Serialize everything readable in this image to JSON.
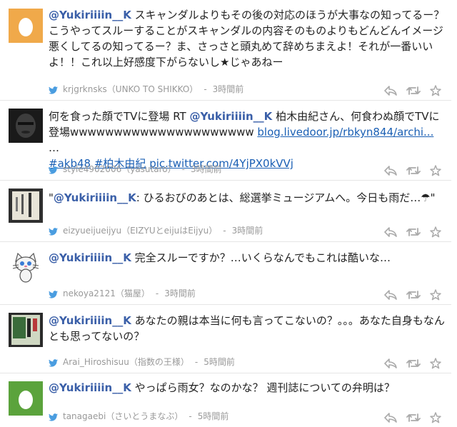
{
  "tweets": [
    {
      "mention": "@Yukiriiiin__K",
      "text": " スキャンダルよりもその後の対応のほうが大事なの知ってるー？こうやってスルーすることがスキャンダルの内容そのものよりもどんどんイメージ悪くしてるの知ってるー？ま、さっさと頭丸めて辞めちまえよ！それが一番いいよ！！これ以上好感度下がらないし★じゃあねー",
      "handle": "krjgrknsks",
      "name": "（UNKO TO SHIKKO）",
      "separator": "-",
      "time": "3時間前",
      "avatar": "egg-orange"
    },
    {
      "text_before": "何を食った顔でTVに登場 RT ",
      "mention": "@Yukiriiiin__K",
      "text": " 柏木由紀さん、何食わぬ顔でTVに登場wwwwwwwwwwwwwwwwwwwww ",
      "link": "blog.livedoor.jp/rbkyn844/archi...",
      "ellipsis": " …",
      "hashtag1": "#akb48",
      "hashtag2": "#柏木由紀",
      "pic_link": "pic.twitter.com/4YjPX0kVVj",
      "handle": "style4902006",
      "name": "（yasutaro）",
      "separator": "-",
      "time": "3時間前",
      "avatar": "dark-portrait"
    },
    {
      "quote_open": "\"",
      "mention": "@Yukiriiiin__K",
      "text": ": ひるおびのあとは、総選挙ミュージアムへ。今日も雨だ…☂\"",
      "handle": "eizyueijueijyu",
      "name": "（EIZYUとeijuはEijyu）",
      "separator": "-",
      "time": "3時間前",
      "avatar": "book-cover"
    },
    {
      "mention": "@Yukiriiiin__K",
      "text": " 完全スルーですか？…いくらなんでもこれは酷いな…",
      "handle": "nekoya2121",
      "name": "（猫屋）",
      "separator": "-",
      "time": "3時間前",
      "avatar": "white-cat"
    },
    {
      "mention": "@Yukiriiiin__K",
      "text": " あなたの親は本当に何も言ってこないの？。。。あなた自身もなんとも思ってないの？",
      "handle": "Arai_Hiroshisuu",
      "name": "（指数の王様）",
      "separator": "-",
      "time": "5時間前",
      "avatar": "book-green"
    },
    {
      "mention": "@Yukiriiiin__K",
      "text": " やっぱら雨女？なのかな？ 週刊誌についての弁明は？",
      "handle": "tanagaebi",
      "name": "（さいとうまなぶ）",
      "separator": "-",
      "time": "5時間前",
      "avatar": "egg-green"
    }
  ],
  "icons": {
    "bird": "twitter-bird-icon",
    "reply": "reply-icon",
    "retweet": "retweet-icon",
    "favorite": "star-icon"
  },
  "colors": {
    "mention": "#3a5fa8",
    "link": "#1a5fb4",
    "meta": "#999999",
    "bird": "#4a9de0",
    "egg_orange_bg": "#f0a94a",
    "egg_green_bg": "#5ba33c"
  }
}
